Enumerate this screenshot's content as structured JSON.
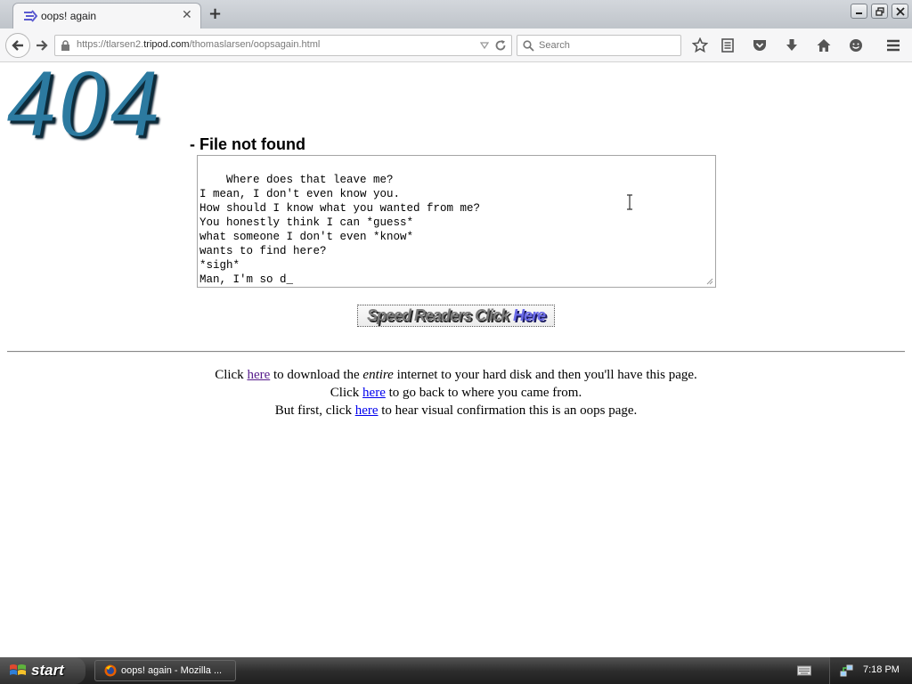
{
  "browser": {
    "tab_title": "oops! again",
    "url_prefix": "https://tlarsen2.",
    "url_domain": "tripod.com",
    "url_path": "/thomaslarsen/oopsagain.html",
    "search_placeholder": "Search"
  },
  "page": {
    "logo_text": "404",
    "subtitle": "- File not found",
    "poem_text": "Where does that leave me?\nI mean, I don't even know you.\nHow should I know what you wanted from me?\nYou honestly think I can *guess*\nwhat someone I don't even *know*\nwants to find here?\n*sigh*\nMan, I'm so d_",
    "speed_button_text": "Speed Readers Click",
    "speed_button_link": "Here",
    "line1": {
      "pre": "Click ",
      "link": "here",
      "mid": " to download the ",
      "em": "entire",
      "post": " internet to your hard disk and then you'll have this page."
    },
    "line2": {
      "pre": "Click ",
      "link": "here",
      "post": " to go back to where you came from."
    },
    "line3": {
      "pre": "But first, click ",
      "link": "here",
      "post": " to hear visual confirmation this is an oops page."
    }
  },
  "taskbar": {
    "start_label": "start",
    "task_label": "oops! again - Mozilla ...",
    "clock": "7:18 PM"
  },
  "colors": {
    "logo": "#2c7aa0",
    "visited_link": "#551a8b",
    "unvisited_link": "#0000ee"
  }
}
